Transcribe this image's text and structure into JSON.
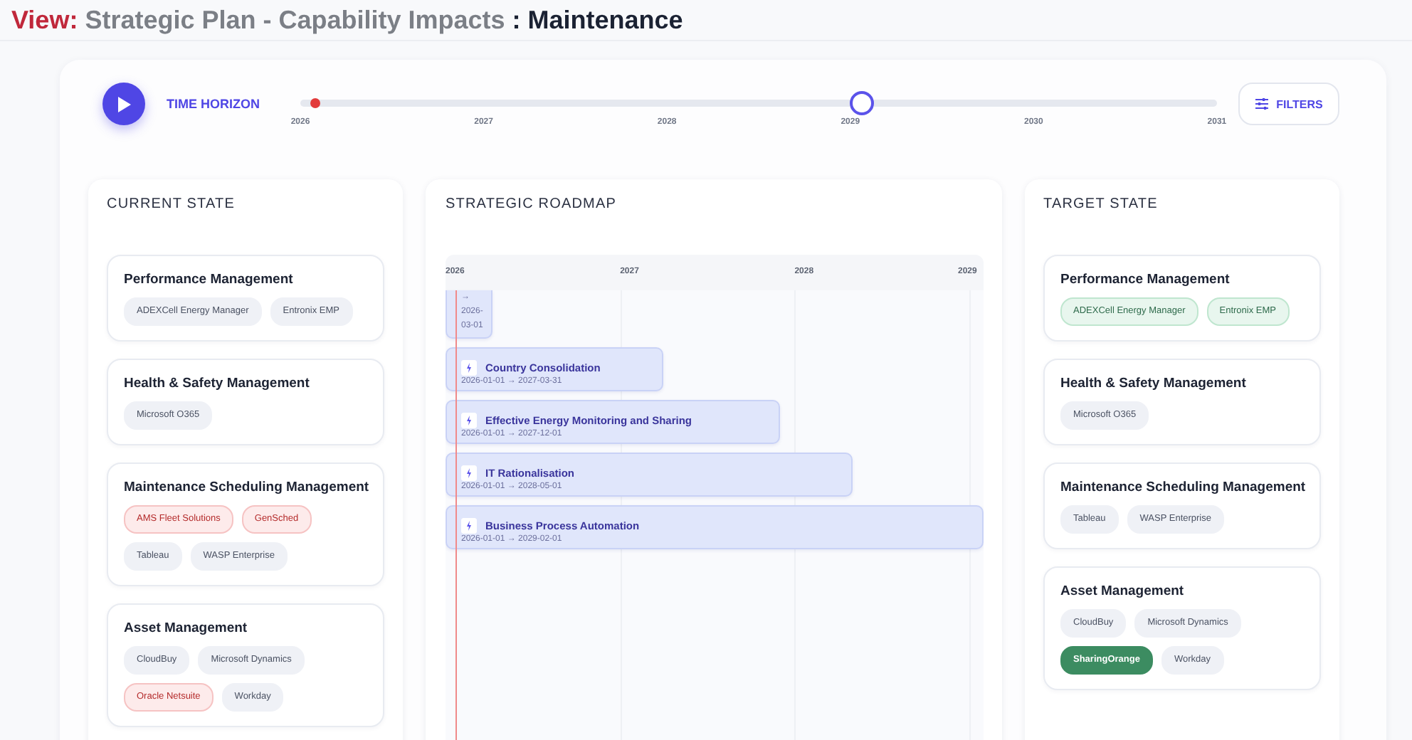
{
  "title": {
    "prefix": "View:",
    "plan": "Strategic Plan - Capability Impacts",
    "name": ": Maintenance"
  },
  "time_horizon": {
    "label": "TIME HORIZON",
    "years": [
      "2026",
      "2027",
      "2028",
      "2029",
      "2030",
      "2031"
    ],
    "today_marker": {
      "level": 0.016
    },
    "slider": {
      "level": 0.612
    }
  },
  "filters_button": {
    "label": "FILTERS"
  },
  "current_state": {
    "heading": "CURRENT STATE",
    "capabilities": [
      {
        "name": "Performance Management",
        "systems": [
          {
            "label": "ADEXCell Energy Manager",
            "kind": "neutral"
          },
          {
            "label": "Entronix EMP",
            "kind": "neutral"
          }
        ]
      },
      {
        "name": "Health & Safety Management",
        "systems": [
          {
            "label": "Microsoft O365",
            "kind": "neutral"
          }
        ]
      },
      {
        "name": "Maintenance Scheduling Management",
        "systems": [
          {
            "label": "AMS Fleet Solutions",
            "kind": "removed"
          },
          {
            "label": "GenSched",
            "kind": "removed"
          },
          {
            "label": "Tableau",
            "kind": "neutral"
          },
          {
            "label": "WASP Enterprise",
            "kind": "neutral"
          }
        ]
      },
      {
        "name": "Asset Management",
        "systems": [
          {
            "label": "CloudBuy",
            "kind": "neutral"
          },
          {
            "label": "Microsoft Dynamics",
            "kind": "neutral"
          },
          {
            "label": "Oracle Netsuite",
            "kind": "removed"
          },
          {
            "label": "Workday",
            "kind": "neutral"
          }
        ]
      }
    ]
  },
  "roadmap": {
    "heading": "STRATEGIC ROADMAP",
    "axis": [
      "2026",
      "2027",
      "2028",
      "2029"
    ],
    "today_marker": {
      "level": 0.018
    },
    "initiatives": [
      {
        "dates": "→ 2026-03-01"
      },
      {
        "name": "Country Consolidation",
        "dates": "2026-01-01 → 2027-03-31"
      },
      {
        "name": "Effective Energy Monitoring and Sharing",
        "dates": "2026-01-01 → 2027-12-01"
      },
      {
        "name": "IT Rationalisation",
        "dates": "2026-01-01 → 2028-05-01"
      },
      {
        "name": "Business Process Automation",
        "dates": "2026-01-01 → 2029-02-01"
      }
    ]
  },
  "target_state": {
    "heading": "TARGET STATE",
    "capabilities": [
      {
        "name": "Performance Management",
        "systems": [
          {
            "label": "ADEXCell Energy Manager",
            "kind": "retained"
          },
          {
            "label": "Entronix EMP",
            "kind": "retained"
          }
        ]
      },
      {
        "name": "Health & Safety Management",
        "systems": [
          {
            "label": "Microsoft O365",
            "kind": "neutral"
          }
        ]
      },
      {
        "name": "Maintenance Scheduling Management",
        "systems": [
          {
            "label": "Tableau",
            "kind": "neutral"
          },
          {
            "label": "WASP Enterprise",
            "kind": "neutral"
          }
        ]
      },
      {
        "name": "Asset Management",
        "systems": [
          {
            "label": "CloudBuy",
            "kind": "neutral"
          },
          {
            "label": "Microsoft Dynamics",
            "kind": "neutral"
          },
          {
            "label": "SharingOrange",
            "kind": "added"
          },
          {
            "label": "Workday",
            "kind": "neutral"
          }
        ]
      }
    ]
  }
}
